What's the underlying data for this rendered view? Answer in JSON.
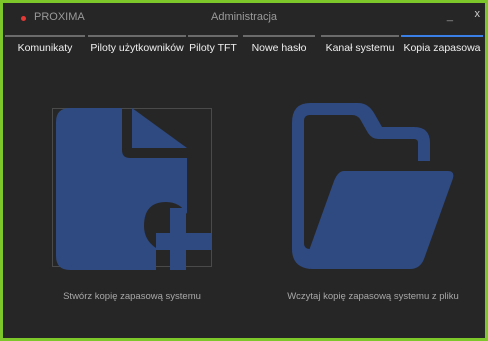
{
  "window": {
    "app_name": "PROXIMA",
    "title": "Administracja",
    "minimize_glyph": "_",
    "close_glyph": "x",
    "border_color": "#7ec72a",
    "app_dot_color": "#e53935"
  },
  "tabs": [
    {
      "label": "Komunikaty",
      "active": false
    },
    {
      "label": "Piloty użytkowników",
      "active": false
    },
    {
      "label": "Piloty TFT",
      "active": false
    },
    {
      "label": "Nowe hasło",
      "active": false
    },
    {
      "label": "Kanał systemu",
      "active": false
    },
    {
      "label": "Kopia zapasowa",
      "active": true
    }
  ],
  "actions": {
    "create_backup": {
      "label": "Stwórz kopię zapasową systemu",
      "icon": "file-plus-icon"
    },
    "load_backup": {
      "label": "Wczytaj kopię zapasową systemu z pliku",
      "icon": "folder-open-icon"
    }
  },
  "colors": {
    "icon_fill": "#2f4a80",
    "active_tab_accent": "#3a7fe6",
    "inactive_tab_accent": "#6b6b6b"
  }
}
